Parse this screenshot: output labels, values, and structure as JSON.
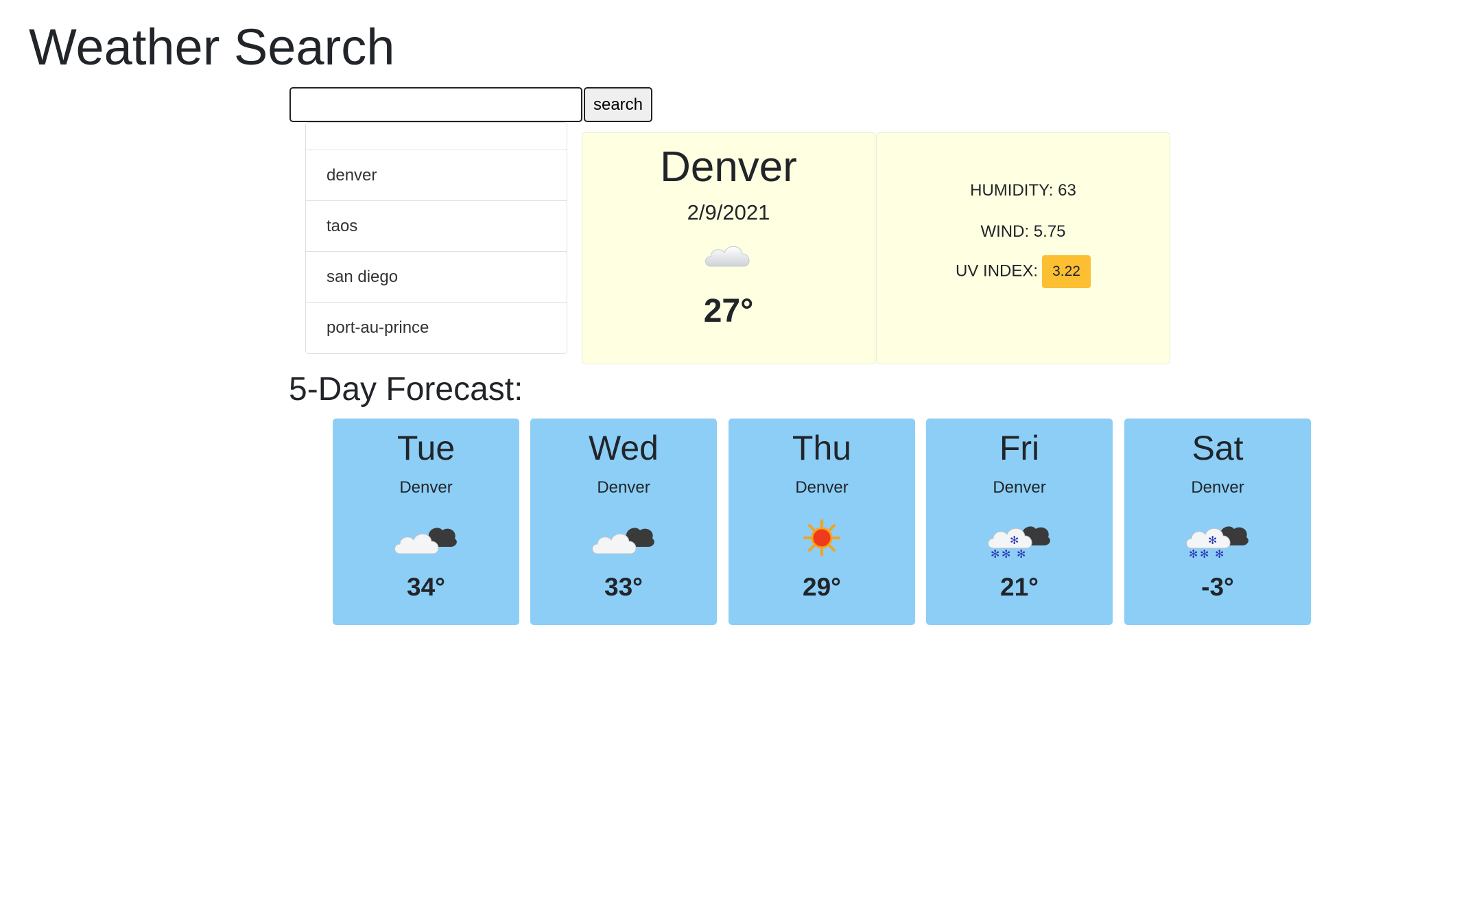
{
  "title": "Weather Search",
  "search": {
    "value": "",
    "placeholder": "",
    "button_label": "search"
  },
  "history": [
    "",
    "denver",
    "taos",
    "san diego",
    "port-au-prince"
  ],
  "current": {
    "city": "Denver",
    "date": "2/9/2021",
    "icon": "cloud-icon",
    "temp": "27°",
    "humidity": "HUMIDITY: 63",
    "wind": "WIND: 5.75",
    "uv_label": "UV INDEX:",
    "uv_value": "3.22",
    "uv_color": "#fcbf32"
  },
  "forecast_heading": "5-Day Forecast:",
  "forecast": [
    {
      "day": "Tue",
      "city": "Denver",
      "icon": "partly-cloudy-icon",
      "temp": "34°"
    },
    {
      "day": "Wed",
      "city": "Denver",
      "icon": "partly-cloudy-icon",
      "temp": "33°"
    },
    {
      "day": "Thu",
      "city": "Denver",
      "icon": "sun-icon",
      "temp": "29°"
    },
    {
      "day": "Fri",
      "city": "Denver",
      "icon": "snow-cloud-icon",
      "temp": "21°"
    },
    {
      "day": "Sat",
      "city": "Denver",
      "icon": "snow-cloud-icon",
      "temp": "-3°"
    }
  ],
  "colors": {
    "current_bg": "#ffffe1",
    "forecast_bg": "#8ccef6"
  }
}
